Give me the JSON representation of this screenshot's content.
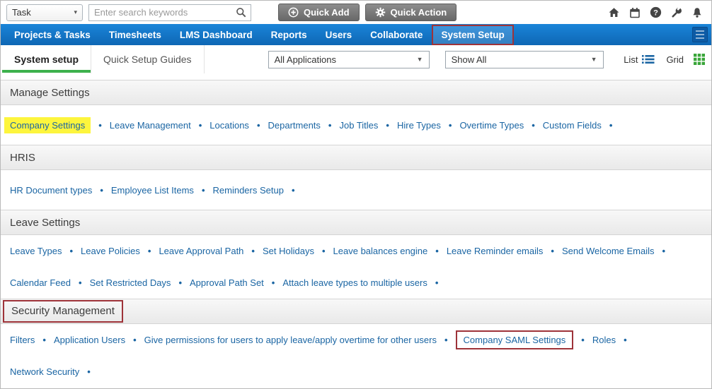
{
  "topbar": {
    "scope_select": {
      "value": "Task"
    },
    "search": {
      "placeholder": "Enter search keywords"
    },
    "quick_add_label": "Quick Add",
    "quick_action_label": "Quick Action"
  },
  "nav": {
    "items": [
      {
        "label": "Projects & Tasks"
      },
      {
        "label": "Timesheets"
      },
      {
        "label": "LMS Dashboard"
      },
      {
        "label": "Reports"
      },
      {
        "label": "Users"
      },
      {
        "label": "Collaborate"
      },
      {
        "label": "System Setup",
        "active": true,
        "annotated": true
      }
    ]
  },
  "subnav": {
    "tabs": [
      {
        "label": "System setup",
        "active": true
      },
      {
        "label": "Quick Setup Guides",
        "active": false
      }
    ],
    "application_filter": {
      "value": "All Applications"
    },
    "show_filter": {
      "value": "Show All"
    },
    "view_toggle": {
      "list_label": "List",
      "grid_label": "Grid"
    }
  },
  "sections": [
    {
      "title": "Manage Settings",
      "rows": [
        [
          "Company Settings",
          "Leave Management",
          "Locations",
          "Departments",
          "Job Titles",
          "Hire Types",
          "Overtime Types",
          "Custom Fields"
        ]
      ]
    },
    {
      "title": "HRIS",
      "rows": [
        [
          "HR Document types",
          "Employee List Items",
          "Reminders Setup"
        ]
      ]
    },
    {
      "title": "Leave Settings",
      "rows": [
        [
          "Leave Types",
          "Leave Policies",
          "Leave Approval Path",
          "Set Holidays",
          "Leave balances engine",
          "Leave Reminder emails",
          "Send Welcome Emails"
        ],
        [
          "Calendar Feed",
          "Set Restricted Days",
          "Approval Path Set",
          "Attach leave types to multiple users"
        ]
      ]
    },
    {
      "title": "Security Management",
      "annotated": true,
      "rows": [
        [
          "Filters",
          "Application Users",
          "Give permissions for users to apply leave/apply overtime for other users",
          "Company SAML Settings",
          "Roles"
        ],
        [
          "Network Security"
        ]
      ]
    }
  ],
  "highlights": {
    "yellow_highlight_link": "Company Settings",
    "red_annotation_boxes": [
      "System Setup",
      "Security Management",
      "Company SAML Settings"
    ]
  },
  "icons": {
    "bullet": "•",
    "chevron_down": "▾",
    "dropdown_arrow": "▼",
    "topbar_right": [
      "home-icon",
      "calendar-icon",
      "help-icon",
      "tools-icon",
      "notifications-icon"
    ]
  },
  "colors": {
    "nav_blue": "#1a85d9",
    "nav_blue_dark": "#0e67b4",
    "link_blue": "#1a65a3",
    "highlight_yellow": "#fdf53d",
    "annotation_red": "#9e3339",
    "tab_green": "#3db14d",
    "grid_green": "#3aa63a",
    "icon_gray": "#454545"
  }
}
